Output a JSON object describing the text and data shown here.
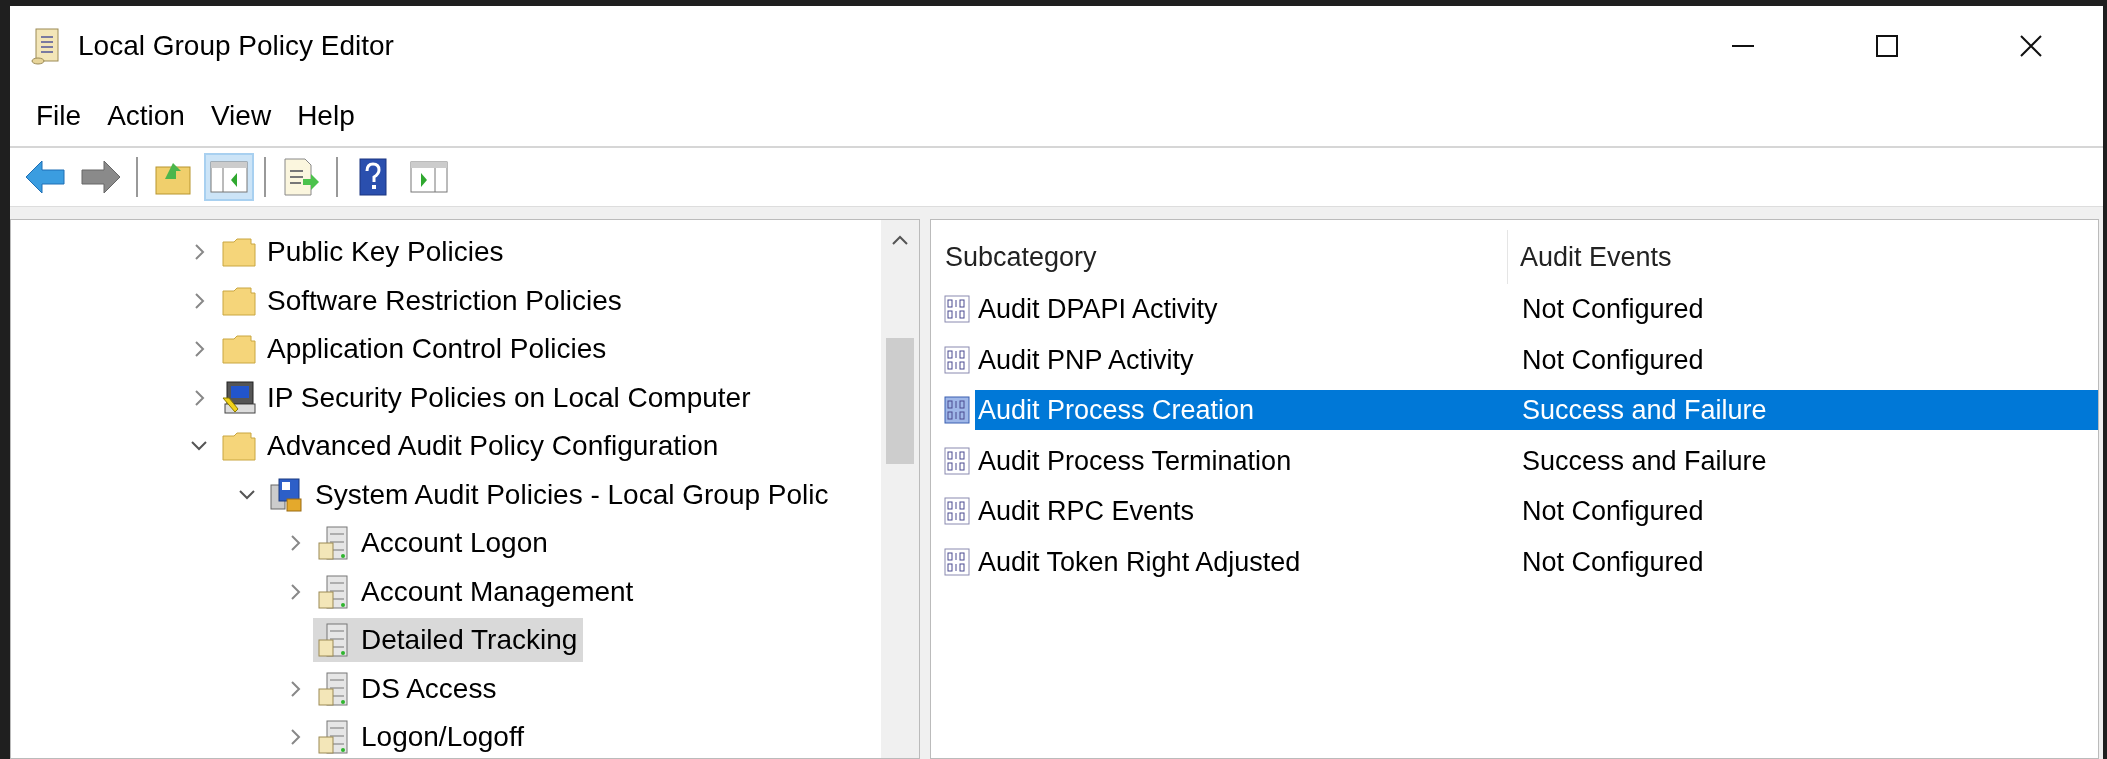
{
  "window": {
    "title": "Local Group Policy Editor"
  },
  "menu": [
    "File",
    "Action",
    "View",
    "Help"
  ],
  "toolbar": [
    [
      {
        "kind": "back",
        "selected": false
      },
      {
        "kind": "forward",
        "selected": false
      }
    ],
    [
      {
        "kind": "up",
        "selected": false
      },
      {
        "kind": "tree",
        "selected": true
      }
    ],
    [
      {
        "kind": "export",
        "selected": false
      }
    ],
    [
      {
        "kind": "help",
        "selected": false
      },
      {
        "kind": "action",
        "selected": false
      }
    ]
  ],
  "tree": [
    {
      "label": "Public Key Policies",
      "kind": "folder",
      "expanded": false,
      "selected": false
    },
    {
      "label": "Software Restriction Policies",
      "kind": "folder",
      "expanded": false,
      "selected": false
    },
    {
      "label": "Application Control Policies",
      "kind": "folder",
      "expanded": false,
      "selected": false
    },
    {
      "label": "IP Security Policies on Local Computer",
      "kind": "computer",
      "expanded": false,
      "selected": false
    },
    {
      "label": "Advanced Audit Policy Configuration",
      "kind": "folder",
      "expanded": true,
      "selected": false,
      "children": [
        {
          "label": "System Audit Policies - Local Group Polic",
          "kind": "policy",
          "expanded": true,
          "selected": false,
          "children": [
            {
              "label": "Account Logon",
              "kind": "category",
              "expanded": false,
              "selected": false
            },
            {
              "label": "Account Management",
              "kind": "category",
              "expanded": false,
              "selected": false
            },
            {
              "label": "Detailed Tracking",
              "kind": "category",
              "selected": true
            },
            {
              "label": "DS Access",
              "kind": "category",
              "expanded": false,
              "selected": false
            },
            {
              "label": "Logon/Logoff",
              "kind": "category",
              "expanded": false,
              "selected": false
            }
          ]
        }
      ]
    }
  ],
  "table": {
    "columns": [
      "Subcategory",
      "Audit Events"
    ],
    "rows": [
      {
        "subcategory": "Audit DPAPI Activity",
        "audit_events": "Not Configured",
        "selected": false
      },
      {
        "subcategory": "Audit PNP Activity",
        "audit_events": "Not Configured",
        "selected": false
      },
      {
        "subcategory": "Audit Process Creation",
        "audit_events": "Success and Failure",
        "selected": true
      },
      {
        "subcategory": "Audit Process Termination",
        "audit_events": "Success and Failure",
        "selected": false
      },
      {
        "subcategory": "Audit RPC Events",
        "audit_events": "Not Configured",
        "selected": false
      },
      {
        "subcategory": "Audit Token Right Adjusted",
        "audit_events": "Not Configured",
        "selected": false
      }
    ]
  }
}
